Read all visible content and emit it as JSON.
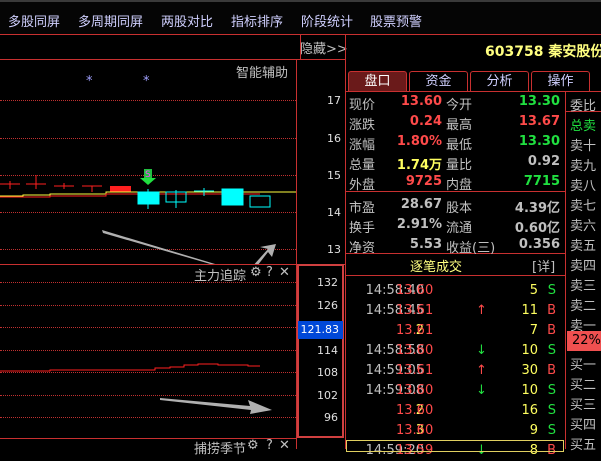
{
  "menu": [
    "多股同屏",
    "多周期同屏",
    "两股对比",
    "指标排序",
    "阶段统计",
    "股票预警"
  ],
  "hide_label": "隐藏>>",
  "main_chart": {
    "title": "智能辅助",
    "axis": [
      "17",
      "16",
      "15",
      "14",
      "13"
    ],
    "signal": "S"
  },
  "sub_chart": {
    "title": "主力追踪",
    "axis": [
      "132",
      "126",
      "114",
      "108",
      "102",
      "96"
    ],
    "current": "121.83"
  },
  "bottom_panel": {
    "title": "捕捞季节"
  },
  "stock": {
    "code": "603758",
    "name": "秦安股份"
  },
  "tabs": [
    "盘口",
    "资金",
    "分析",
    "操作"
  ],
  "quote": [
    {
      "l1": "现价",
      "v1": "13.60",
      "c1": "r",
      "l2": "今开",
      "v2": "13.30",
      "c2": "g"
    },
    {
      "l1": "涨跌",
      "v1": "0.24",
      "c1": "r",
      "l2": "最高",
      "v2": "13.67",
      "c2": "r"
    },
    {
      "l1": "涨幅",
      "v1": "1.80%",
      "c1": "r",
      "l2": "最低",
      "v2": "13.30",
      "c2": "g"
    },
    {
      "l1": "总量",
      "v1": "1.74万",
      "c1": "y",
      "l2": "量比",
      "v2": "0.92",
      "c2": "w"
    },
    {
      "l1": "外盘",
      "v1": "9725",
      "c1": "r",
      "l2": "内盘",
      "v2": "7715",
      "c2": "g"
    },
    {
      "l1": "市盈",
      "v1": "28.67",
      "c1": "w",
      "l2": "股本",
      "v2": "4.39亿",
      "c2": "w"
    },
    {
      "l1": "换手",
      "v1": "2.91%",
      "c1": "w",
      "l2": "流通",
      "v2": "0.60亿",
      "c2": "w"
    },
    {
      "l1": "净资",
      "v1": "5.53",
      "c1": "w",
      "l2": "收益(三)",
      "v2": "0.356",
      "c2": "w"
    }
  ],
  "ticks": {
    "title": "逐笔成交",
    "detail": "[详]",
    "rows": [
      {
        "time": "14:58:40",
        "price": "13.60",
        "arrow": "",
        "vol": "5",
        "side": "S"
      },
      {
        "time": "14:58:45",
        "price": "13.61",
        "arrow": "↑",
        "vol": "11",
        "side": "B"
      },
      {
        "time": "2",
        "price": "13.61",
        "arrow": "",
        "vol": "7",
        "side": "B"
      },
      {
        "time": "14:58:58",
        "price": "13.60",
        "arrow": "↓",
        "vol": "10",
        "side": "S"
      },
      {
        "time": "14:59:05",
        "price": "13.61",
        "arrow": "↑",
        "vol": "30",
        "side": "B"
      },
      {
        "time": "14:59:08",
        "price": "13.60",
        "arrow": "↓",
        "vol": "10",
        "side": "S"
      },
      {
        "time": "2",
        "price": "13.60",
        "arrow": "",
        "vol": "16",
        "side": "S"
      },
      {
        "time": "3",
        "price": "13.60",
        "arrow": "",
        "vol": "9",
        "side": "S"
      },
      {
        "time": "14:59:20",
        "price": "13.59",
        "arrow": "↓",
        "vol": "8",
        "side": "B"
      }
    ]
  },
  "order_book": {
    "ratio_label": "委比",
    "total_sell": "总卖",
    "sells": [
      "卖十",
      "卖九",
      "卖八",
      "卖七",
      "卖六",
      "卖五",
      "卖四",
      "卖三",
      "卖二",
      "卖一"
    ],
    "ratio_value": "22%",
    "buys": [
      "买一",
      "买二",
      "买三",
      "买四",
      "买五"
    ]
  }
}
